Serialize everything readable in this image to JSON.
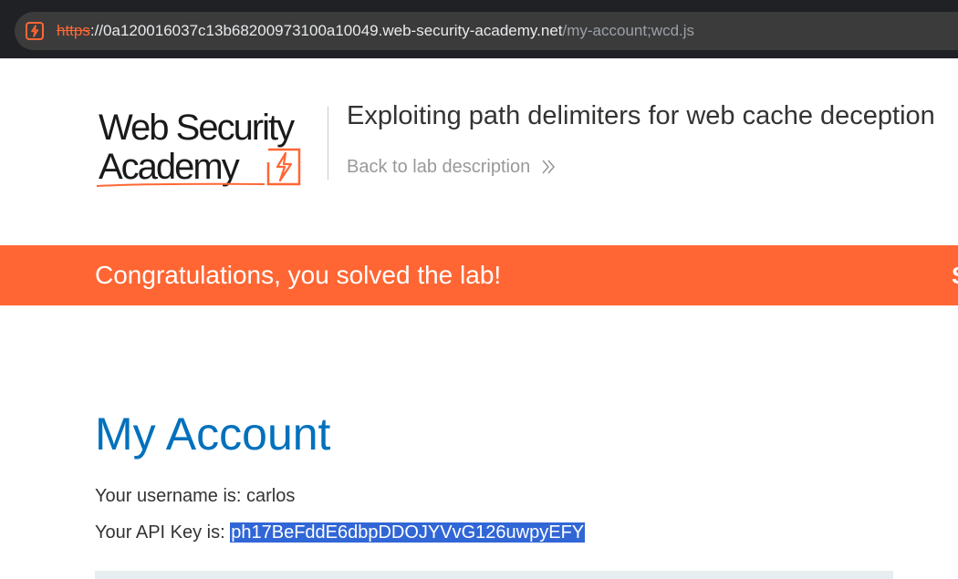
{
  "browser": {
    "url_scheme": "https",
    "url_separator": "://",
    "url_host": "0a120016037c13b68200973100a10049.web-security-academy.net",
    "url_path": "/my-account;wcd.js",
    "site_icon": "lightning-square-icon"
  },
  "header": {
    "logo_line1": "Web Security",
    "logo_line2": "Academy",
    "lab_title": "Exploiting path delimiters for web cache deception",
    "back_link": "Back to lab description",
    "back_icon": "double-chevron-right-icon"
  },
  "banner": {
    "message": "Congratulations, you solved the lab!",
    "edge_text": "S"
  },
  "account": {
    "heading": "My Account",
    "username_label": "Your username is: ",
    "username": "carlos",
    "apikey_label": "Your API Key is: ",
    "apikey": "ph17BeFddE6dbpDDOJYVvG126uwpyEFY"
  },
  "colors": {
    "brand_orange": "#ff6633",
    "heading_blue": "#0071bc",
    "selection_blue": "#3166d6"
  }
}
